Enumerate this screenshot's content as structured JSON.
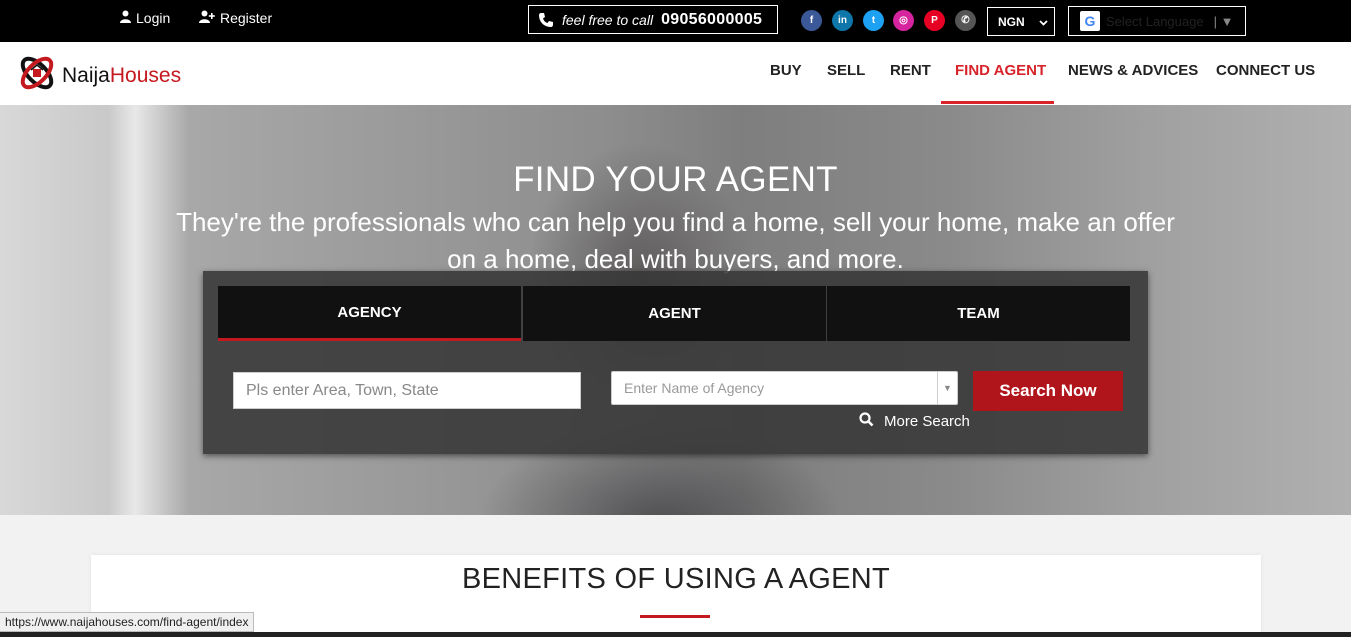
{
  "topbar": {
    "login_label": "Login",
    "register_label": "Register",
    "call_prefix": "feel free to call",
    "phone_number": "09056000005",
    "social": [
      {
        "name": "facebook-icon",
        "glyph": "f",
        "color": "#3b5998"
      },
      {
        "name": "linkedin-icon",
        "glyph": "in",
        "color": "#0e76a8"
      },
      {
        "name": "twitter-icon",
        "glyph": "t",
        "color": "#1da1f2"
      },
      {
        "name": "instagram-icon",
        "glyph": "◎",
        "color": "#d6249f"
      },
      {
        "name": "pinterest-icon",
        "glyph": "P",
        "color": "#e60023"
      },
      {
        "name": "whatsapp-icon",
        "glyph": "✆",
        "color": "#555555"
      }
    ],
    "currency_value": "NGN",
    "language_placeholder": "Select Language"
  },
  "nav": {
    "logo_part1": "Naija",
    "logo_part2": "Houses",
    "items": [
      "BUY",
      "SELL",
      "RENT",
      "FIND AGENT",
      "NEWS & ADVICES",
      "CONNECT US"
    ],
    "active": "FIND AGENT"
  },
  "hero": {
    "title": "FIND YOUR AGENT",
    "subtitle": "They're the professionals who can help you find a home, sell your home, make an offer on a home, deal with buyers, and more."
  },
  "search": {
    "tabs": [
      "AGENCY",
      "AGENT",
      "TEAM"
    ],
    "active_tab": "AGENCY",
    "location_placeholder": "Pls enter Area, Town, State",
    "agency_placeholder": "Enter Name of Agency",
    "button_label": "Search Now",
    "more_search_label": "More Search"
  },
  "benefits": {
    "title": "BENEFITS OF USING A AGENT"
  },
  "status_bar": {
    "url": "https://www.naijahouses.com/find-agent/index"
  },
  "colors": {
    "brand_red": "#c41a1f",
    "active_nav": "#d8232a",
    "button_red": "#b0151b"
  }
}
